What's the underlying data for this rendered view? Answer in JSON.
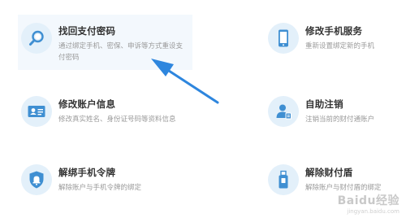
{
  "services": [
    {
      "id": "find-password",
      "title": "找回支付密码",
      "desc": "通过绑定手机、密保、申诉等方式重设支付密码",
      "icon": "magnifier-icon"
    },
    {
      "id": "change-phone",
      "title": "修改手机服务",
      "desc": "重新设置绑定新的手机",
      "icon": "phone-icon"
    },
    {
      "id": "modify-account",
      "title": "修改账户信息",
      "desc": "修改真实姓名、身份证号码等资料信息",
      "icon": "id-card-icon"
    },
    {
      "id": "self-cancel",
      "title": "自助注销",
      "desc": "注销当前的财付通账户",
      "icon": "user-cancel-icon"
    },
    {
      "id": "unbind-token",
      "title": "解绑手机令牌",
      "desc": "解除账户与手机令牌的绑定",
      "icon": "shield-bell-icon"
    },
    {
      "id": "unbind-shield",
      "title": "解除财付盾",
      "desc": "解除账户与财付盾的绑定",
      "icon": "usb-key-icon"
    }
  ],
  "watermark": {
    "logo": "Baidu经验",
    "url": "jingyan.baidu.com"
  },
  "colors": {
    "icon_bg": "#e3f0fa",
    "icon_blue": "#3f8fd2",
    "arrow": "#2e86de",
    "active_bg": "#f3f8fd"
  }
}
